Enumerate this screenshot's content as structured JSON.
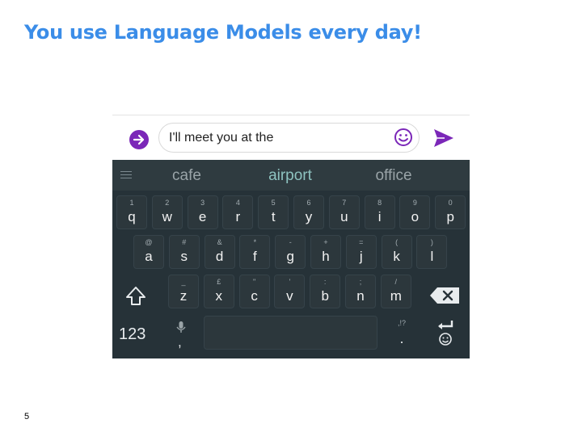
{
  "slide": {
    "title": "You use Language Models every day!",
    "page_number": "5"
  },
  "compose": {
    "message_text": "I'll meet you at the"
  },
  "keyboard": {
    "suggestions": [
      "cafe",
      "airport",
      "office"
    ],
    "row1": [
      {
        "hint": "1",
        "key": "q"
      },
      {
        "hint": "2",
        "key": "w"
      },
      {
        "hint": "3",
        "key": "e"
      },
      {
        "hint": "4",
        "key": "r"
      },
      {
        "hint": "5",
        "key": "t"
      },
      {
        "hint": "6",
        "key": "y"
      },
      {
        "hint": "7",
        "key": "u"
      },
      {
        "hint": "8",
        "key": "i"
      },
      {
        "hint": "9",
        "key": "o"
      },
      {
        "hint": "0",
        "key": "p"
      }
    ],
    "row2": [
      {
        "hint": "@",
        "key": "a"
      },
      {
        "hint": "#",
        "key": "s"
      },
      {
        "hint": "&",
        "key": "d"
      },
      {
        "hint": "*",
        "key": "f"
      },
      {
        "hint": "-",
        "key": "g"
      },
      {
        "hint": "+",
        "key": "h"
      },
      {
        "hint": "=",
        "key": "j"
      },
      {
        "hint": "(",
        "key": "k"
      },
      {
        "hint": ")",
        "key": "l"
      }
    ],
    "row3": [
      {
        "hint": "_",
        "key": "z"
      },
      {
        "hint": "£",
        "key": "x"
      },
      {
        "hint": "\"",
        "key": "c"
      },
      {
        "hint": "'",
        "key": "v"
      },
      {
        "hint": ":",
        "key": "b"
      },
      {
        "hint": ";",
        "key": "n"
      },
      {
        "hint": "/",
        "key": "m"
      }
    ],
    "num_label": "123",
    "comma_label": ",",
    "period_hint": ",!?",
    "period_label": "."
  },
  "colors": {
    "title": "#3b8de8",
    "accent_purple": "#7b27b8",
    "keyboard_bg": "#263238",
    "suggestion_highlight": "#8ec3c0"
  },
  "icons": {
    "expand": "arrow-right-circle-icon",
    "emoji": "smiley-icon",
    "send": "send-icon",
    "menu": "hamburger-menu-icon",
    "shift": "shift-arrow-icon",
    "backspace": "backspace-icon",
    "mic": "microphone-icon",
    "enter": "enter-icon"
  }
}
